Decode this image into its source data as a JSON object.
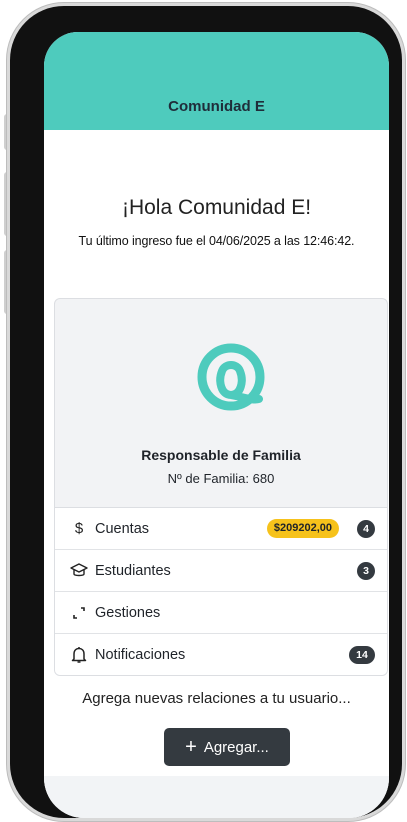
{
  "header": {
    "title": "Comunidad E"
  },
  "welcome": {
    "greeting": "¡Hola Comunidad E!",
    "last_login": "Tu último ingreso fue el 04/06/2025 a las 12:46:42."
  },
  "profile": {
    "role": "Responsable de Familia",
    "family_number": "Nº de Familia: 680",
    "brand_color": "#4ecbbd"
  },
  "menu": [
    {
      "icon": "dollar-icon",
      "label": "Cuentas",
      "amount": "$209202,00",
      "count": "4"
    },
    {
      "icon": "graduation-cap-icon",
      "label": "Estudiantes",
      "count": "3"
    },
    {
      "icon": "expand-corners-icon",
      "label": "Gestiones"
    },
    {
      "icon": "bell-icon",
      "label": "Notificaciones",
      "count": "14"
    }
  ],
  "add": {
    "prompt": "Agrega nuevas relaciones a tu usuario...",
    "button_label": "Agregar..."
  },
  "colors": {
    "accent": "#4ecbbd",
    "badge_amount": "#f6c21b",
    "badge_count": "#343a40"
  }
}
